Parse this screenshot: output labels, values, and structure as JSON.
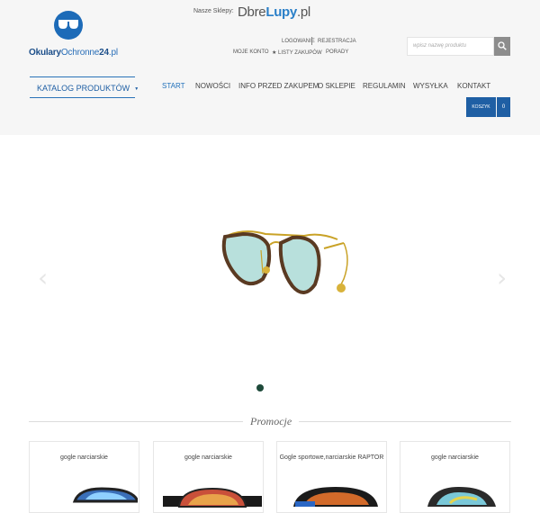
{
  "header": {
    "logo": {
      "bold": "Okulary",
      "light": "Ochronne",
      "suffix": "24",
      "tld": ".pl"
    },
    "stores_label": "Nasze Sklepy:",
    "store": {
      "part1": "D",
      "part2": "bre",
      "part3": "Lupy",
      "part4": ".pl"
    },
    "links": {
      "login": "Logowanie",
      "register": "Rejestracja",
      "account": "Moje konto",
      "lists": "★ Listy zakupów",
      "advice": "Porady"
    },
    "search": {
      "placeholder": "wpisz nazwę produktu"
    },
    "catalog": {
      "label": "KATALOG PRODUKTÓW",
      "caret": "▼"
    },
    "nav": [
      "START",
      "NOWOŚCI",
      "INFO PRZED ZAKUPEM",
      "O SKLEPIE",
      "REGULAMIN",
      "WYSYŁKA",
      "KONTAKT"
    ],
    "cart": {
      "label": "Koszyk",
      "count": "0"
    }
  },
  "slider": {
    "prev": "‹",
    "next": "›",
    "active_slide": 1,
    "slide_count": 1
  },
  "promo": {
    "title": "Promocje",
    "products": [
      {
        "title": "gogle narciarskie"
      },
      {
        "title": "gogle narciarskie"
      },
      {
        "title": "Gogle sportowe,narciarskie RAPTOR"
      },
      {
        "title": "gogle narciarskie"
      }
    ]
  },
  "colors": {
    "accent": "#1f5fa4",
    "nav_active": "#1f6fba",
    "header_bg": "#f6f6f6"
  }
}
